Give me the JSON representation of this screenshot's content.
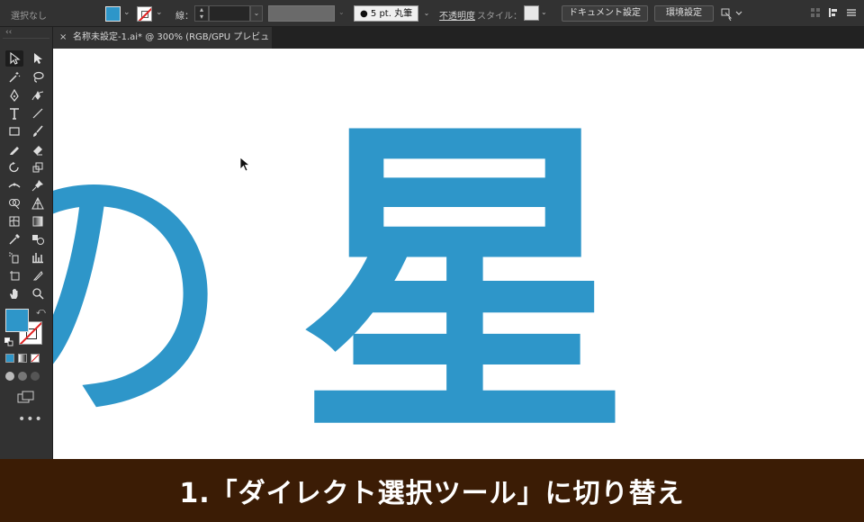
{
  "control_bar": {
    "selection_label": "選択なし",
    "stroke_label": "線：",
    "brush_label": "5 pt. 丸筆",
    "opacity_label": "不透明度",
    "style_label": "スタイル：",
    "document_settings_button": "ドキュメント設定",
    "preferences_button": "環境設定"
  },
  "document_tab": {
    "title": "名称未設定-1.ai* @ 300% (RGB/GPU プレビュー)",
    "close_glyph": "×"
  },
  "toolbar": {
    "collapse_glyph": "‹‹",
    "more_glyph": "•••"
  },
  "colors": {
    "fill": "#2e96c9",
    "stroke_none_slash": "#e02020"
  },
  "icons": {
    "selection": "selection-arrow-icon",
    "direct_selection": "direct-selection-arrow-icon",
    "cursor": "cursor-arrow-icon"
  },
  "artwork": {
    "glyph_left": "の",
    "glyph_main": "星"
  },
  "caption": {
    "text": "1.「ダイレクト選択ツール」に切り替え"
  }
}
